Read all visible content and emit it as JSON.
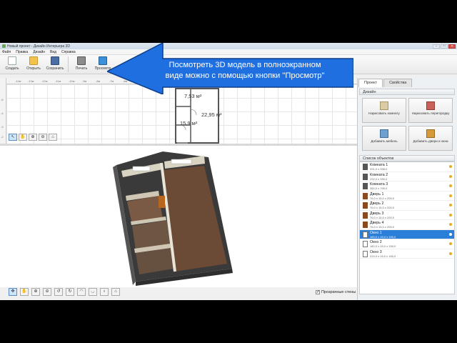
{
  "window": {
    "title": "Новый проект - Дизайн Интерьера 3D",
    "controls": [
      "–",
      "□",
      "×"
    ]
  },
  "menu": [
    "Файл",
    "Правка",
    "Дизайн",
    "Вид",
    "Справка"
  ],
  "toolbar": {
    "create": "Создать",
    "open": "Открыть",
    "save": "Сохранить",
    "print": "Печать",
    "preview": "Просмотр"
  },
  "callout": {
    "line1": "Посмотреть 3D модель в полноэкранном",
    "line2": "виде можно с помощью кнопки \"Просмотр\""
  },
  "plan": {
    "ruler_marks": [
      "-14м",
      "-13м",
      "-12м",
      "-11м",
      "-10м",
      "-9м",
      "-8м",
      "-7м",
      "-6м",
      "-5м",
      "-4м"
    ],
    "ruler_left": [
      "-6",
      "-4",
      "-3",
      "-2"
    ],
    "room_areas": [
      "7,53 м²",
      "22,95 м²",
      "15,9 м²"
    ]
  },
  "bottom": {
    "transparent_walls": "Прозрачные стены",
    "transparent_walls_checked": true
  },
  "panel": {
    "tabs": [
      "Проект",
      "Свойства"
    ],
    "design_header": "Дизайн",
    "buttons": {
      "draw_room": "Нарисовать комнату",
      "draw_partition": "Нарисовать перегородку",
      "add_furniture": "Добавить мебель",
      "add_doors_windows": "Добавить двери и окна"
    },
    "objects_header": "Список объектов",
    "objects": [
      {
        "name": "Комната 1",
        "dim": "331,0 x 338,0",
        "type": "room"
      },
      {
        "name": "Комната 2",
        "dim": "232,0 x 330,0",
        "type": "room"
      },
      {
        "name": "Комната 3",
        "dim": "350,0 x 795,0",
        "type": "room"
      },
      {
        "name": "Дверь 1",
        "dim": "76,0 x 15,0 x 200,0",
        "type": "door"
      },
      {
        "name": "Дверь 2",
        "dim": "76,0 x 15,0 x 200,0",
        "type": "door"
      },
      {
        "name": "Дверь 3",
        "dim": "76,0 x 15,0 x 200,0",
        "type": "door"
      },
      {
        "name": "Дверь 4",
        "dim": "76,0 x 15,0 x 200,0",
        "type": "door"
      },
      {
        "name": "Окно 1",
        "dim": "160,0 x 15,0 x 150,0",
        "type": "window",
        "selected": true
      },
      {
        "name": "Окно 2",
        "dim": "160,0 x 15,0 x 150,0",
        "type": "window"
      },
      {
        "name": "Окно 3",
        "dim": "224,0 x 15,0 x 150,0",
        "type": "window"
      }
    ]
  },
  "colors": {
    "accent": "#2b7fd8",
    "callout": "#1f6fe0",
    "floor": "#6b4a36"
  }
}
